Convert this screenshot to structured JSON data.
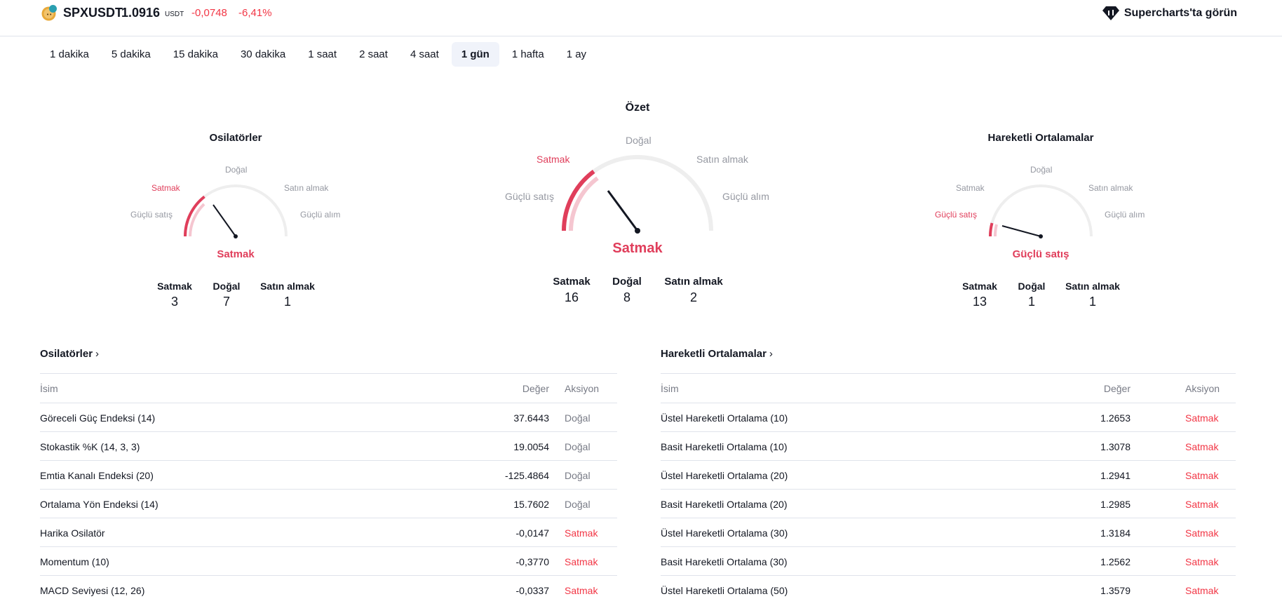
{
  "header": {
    "symbol": "SPXUSDT",
    "price": "1.0916",
    "currency": "USDT",
    "change": "-0,0748",
    "change_pct": "-6,41%",
    "supercharts_label": "Supercharts'ta görün",
    "logo_icon": "spx-coin-icon",
    "supercharts_icon": "tradingview-diamond-icon",
    "accent_color": "#f23645"
  },
  "intervals": [
    "1 dakika",
    "5 dakika",
    "15 dakika",
    "30 dakika",
    "1 saat",
    "2 saat",
    "4 saat",
    "1 gün",
    "1 hafta",
    "1 ay"
  ],
  "active_interval": "1 gün",
  "gauges": {
    "oscillators": {
      "title": "Osilatörler",
      "labels": {
        "strong_sell": "Güçlü satış",
        "sell": "Satmak",
        "neutral": "Doğal",
        "buy": "Satın almak",
        "strong_buy": "Güçlü alım"
      },
      "result": "Satmak",
      "counts": [
        {
          "label": "Satmak",
          "value": "3"
        },
        {
          "label": "Doğal",
          "value": "7"
        },
        {
          "label": "Satın almak",
          "value": "1"
        }
      ]
    },
    "summary": {
      "title": "Özet",
      "labels": {
        "strong_sell": "Güçlü satış",
        "sell": "Satmak",
        "neutral": "Doğal",
        "buy": "Satın almak",
        "strong_buy": "Güçlü alım"
      },
      "result": "Satmak",
      "counts": [
        {
          "label": "Satmak",
          "value": "16"
        },
        {
          "label": "Doğal",
          "value": "8"
        },
        {
          "label": "Satın almak",
          "value": "2"
        }
      ]
    },
    "moving_averages": {
      "title": "Hareketli Ortalamalar",
      "labels": {
        "strong_sell": "Güçlü satış",
        "sell": "Satmak",
        "neutral": "Doğal",
        "buy": "Satın almak",
        "strong_buy": "Güçlü alım"
      },
      "result": "Güçlü satış",
      "counts": [
        {
          "label": "Satmak",
          "value": "13"
        },
        {
          "label": "Doğal",
          "value": "1"
        },
        {
          "label": "Satın almak",
          "value": "1"
        }
      ]
    }
  },
  "oscillators_table": {
    "title": "Osilatörler",
    "headers": {
      "name": "İsim",
      "value": "Değer",
      "action": "Aksiyon"
    },
    "rows": [
      {
        "name": "Göreceli Güç Endeksi (14)",
        "value": "37.6443",
        "action": "Doğal"
      },
      {
        "name": "Stokastik %K (14, 3, 3)",
        "value": "19.0054",
        "action": "Doğal"
      },
      {
        "name": "Emtia Kanalı Endeksi (20)",
        "value": "-125.4864",
        "action": "Doğal"
      },
      {
        "name": "Ortalama Yön Endeksi (14)",
        "value": "15.7602",
        "action": "Doğal"
      },
      {
        "name": "Harika Osilatör",
        "value": "-0,0147",
        "action": "Satmak"
      },
      {
        "name": "Momentum (10)",
        "value": "-0,3770",
        "action": "Satmak"
      },
      {
        "name": "MACD Seviyesi (12, 26)",
        "value": "-0,0337",
        "action": "Satmak"
      }
    ]
  },
  "ma_table": {
    "title": "Hareketli Ortalamalar",
    "headers": {
      "name": "İsim",
      "value": "Değer",
      "action": "Aksiyon"
    },
    "rows": [
      {
        "name": "Üstel Hareketli Ortalama (10)",
        "value": "1.2653",
        "action": "Satmak"
      },
      {
        "name": "Basit Hareketli Ortalama (10)",
        "value": "1.3078",
        "action": "Satmak"
      },
      {
        "name": "Üstel Hareketli Ortalama (20)",
        "value": "1.2941",
        "action": "Satmak"
      },
      {
        "name": "Basit Hareketli Ortalama (20)",
        "value": "1.2985",
        "action": "Satmak"
      },
      {
        "name": "Üstel Hareketli Ortalama (30)",
        "value": "1.3184",
        "action": "Satmak"
      },
      {
        "name": "Basit Hareketli Ortalama (30)",
        "value": "1.2562",
        "action": "Satmak"
      },
      {
        "name": "Üstel Hareketli Ortalama (50)",
        "value": "1.3579",
        "action": "Satmak"
      }
    ]
  }
}
